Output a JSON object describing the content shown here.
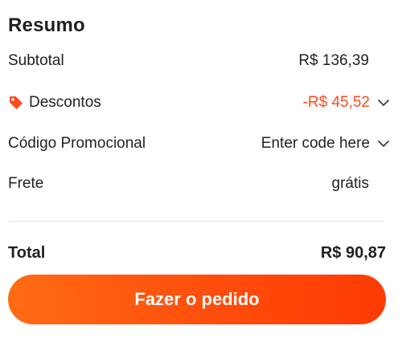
{
  "summary": {
    "title": "Resumo",
    "subtotal": {
      "label": "Subtotal",
      "value": "R$ 136,39"
    },
    "discounts": {
      "label": "Descontos",
      "value": "-R$ 45,52",
      "icon": "tag-icon",
      "color": "#ff4a1f"
    },
    "promo_code": {
      "label": "Código Promocional",
      "value": "Enter code here",
      "icon": "chevron-down-icon"
    },
    "shipping": {
      "label": "Frete",
      "value": "grátis"
    },
    "total": {
      "label": "Total",
      "value": "R$ 90,87"
    },
    "order_button": {
      "label": "Fazer o pedido",
      "color_start": "#ff6b13",
      "color_end": "#ff3a05"
    }
  }
}
